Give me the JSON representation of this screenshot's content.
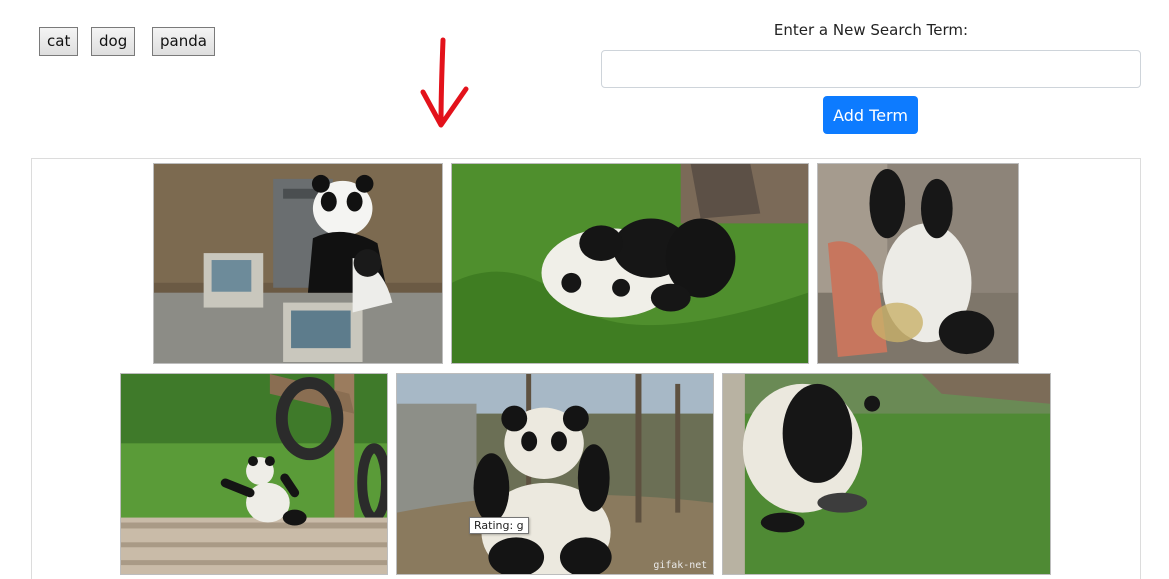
{
  "term_buttons": [
    "cat",
    "dog",
    "panda"
  ],
  "search": {
    "label": "Enter a New Search Term:",
    "value": "",
    "placeholder": "",
    "add_label": "Add Term"
  },
  "gifs": [
    {
      "subject": "panda costume at office desk with computers"
    },
    {
      "subject": "panda rolling in grass"
    },
    {
      "subject": "panda falling backward from wicker chair"
    },
    {
      "subject": "panda cub lying on log near hanging tire"
    },
    {
      "subject": "panda sitting up with raised paw"
    },
    {
      "subject": "panda face-down on grass"
    }
  ],
  "tooltip": {
    "text": "Rating: g"
  },
  "watermark": "gifak-net",
  "colors": {
    "accent": "#0d7bff",
    "annotation_arrow": "#e3121b"
  }
}
